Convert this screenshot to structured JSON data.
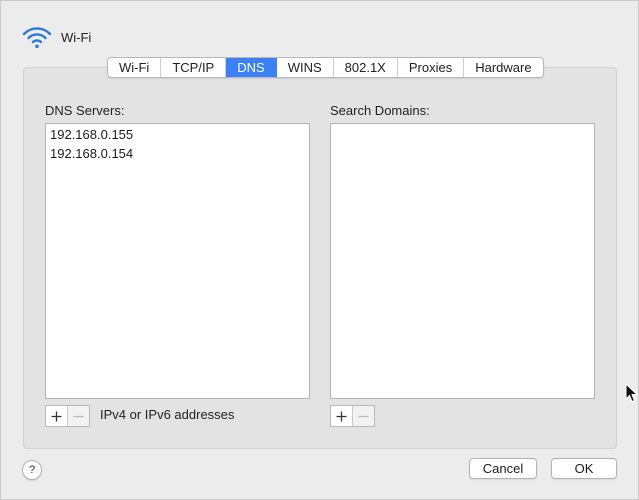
{
  "window": {
    "title": "Wi-Fi"
  },
  "tabs": [
    {
      "label": "Wi-Fi",
      "active": false
    },
    {
      "label": "TCP/IP",
      "active": false
    },
    {
      "label": "DNS",
      "active": true
    },
    {
      "label": "WINS",
      "active": false
    },
    {
      "label": "802.1X",
      "active": false
    },
    {
      "label": "Proxies",
      "active": false
    },
    {
      "label": "Hardware",
      "active": false
    }
  ],
  "dns_servers": {
    "label": "DNS Servers:",
    "entries": [
      "192.168.0.155",
      "192.168.0.154"
    ],
    "hint": "IPv4 or IPv6 addresses"
  },
  "search_domains": {
    "label": "Search Domains:",
    "entries": []
  },
  "footer": {
    "help_label": "?",
    "cancel_label": "Cancel",
    "ok_label": "OK"
  },
  "colors": {
    "accent": "#3b80f5",
    "wifi_icon": "#2c77d8"
  },
  "icons": {
    "wifi": "wifi-icon",
    "add": "plus-icon",
    "remove": "minus-icon",
    "pointer": "cursor-icon"
  }
}
